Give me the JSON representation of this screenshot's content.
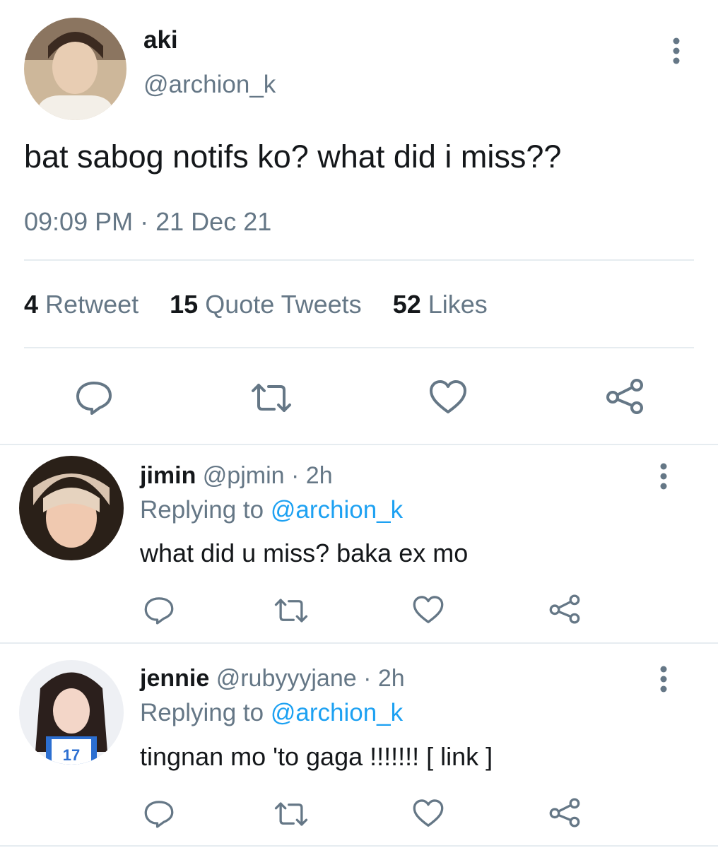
{
  "main_tweet": {
    "name": "aki",
    "handle": "@archion_k",
    "text": "bat sabog notifs ko? what did i miss??",
    "time": "09:09 PM",
    "date": "21 Dec 21",
    "separator": "·",
    "stats": {
      "retweets_count": "4",
      "retweets_label": "Retweet",
      "quotes_count": "15",
      "quotes_label": "Quote Tweets",
      "likes_count": "52",
      "likes_label": "Likes"
    }
  },
  "replies": [
    {
      "name": "jimin",
      "handle": "@pjmin",
      "sep": "·",
      "time": "2h",
      "replying_label": "Replying to",
      "replying_to": "@archion_k",
      "text": "what did u miss? baka ex mo"
    },
    {
      "name": "jennie",
      "handle": "@rubyyyjane",
      "sep": "·",
      "time": "2h",
      "replying_label": "Replying to",
      "replying_to": "@archion_k",
      "text": "tingnan mo 'to gaga !!!!!!! [ link ]"
    }
  ],
  "icons": [
    "more-vert-icon",
    "reply-icon",
    "retweet-icon",
    "like-icon",
    "share-icon"
  ],
  "colors": {
    "text": "#14171a",
    "secondary": "#657786",
    "mention": "#1da1f2",
    "divider": "#e6ecf0"
  }
}
